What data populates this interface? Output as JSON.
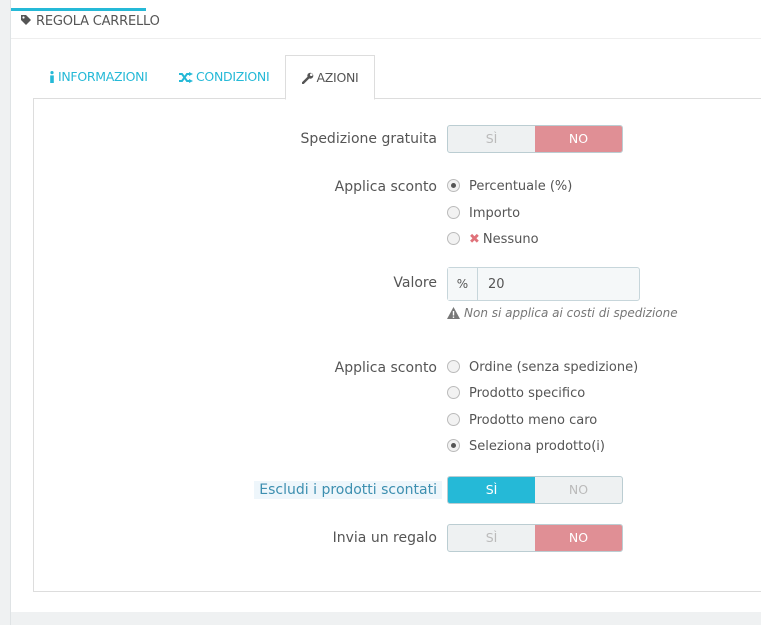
{
  "panel": {
    "title": "REGOLA CARRELLO"
  },
  "tabs": [
    {
      "label": "INFORMAZIONI",
      "icon": "info-icon"
    },
    {
      "label": "CONDIZIONI",
      "icon": "random-icon"
    },
    {
      "label": "AZIONI",
      "icon": "wrench-icon",
      "active": true
    }
  ],
  "actions": {
    "free_shipping": {
      "label": "Spedizione gratuita",
      "yes": "SÌ",
      "no": "NO",
      "value": "no"
    },
    "apply_discount": {
      "label": "Applica sconto",
      "options": [
        "Percentuale (%)",
        "Importo",
        "Nessuno"
      ],
      "selected": "Percentuale (%)"
    },
    "value": {
      "label": "Valore",
      "addon": "%",
      "amount": "20",
      "help": "Non si applica ai costi di spedizione"
    },
    "apply_discount_to": {
      "label": "Applica sconto",
      "options": [
        "Ordine (senza spedizione)",
        "Prodotto specifico",
        "Prodotto meno caro",
        "Seleziona prodotto(i)"
      ],
      "selected": "Seleziona prodotto(i)"
    },
    "exclude_discounted": {
      "label": "Escludi i prodotti scontati",
      "yes": "SÌ",
      "no": "NO",
      "value": "yes"
    },
    "send_gift": {
      "label": "Invia un regalo",
      "yes": "SÌ",
      "no": "NO",
      "value": "no"
    }
  },
  "colors": {
    "accent": "#25b9d7",
    "switch_no": "#e08f95",
    "switch_yes": "#25b9d7"
  }
}
